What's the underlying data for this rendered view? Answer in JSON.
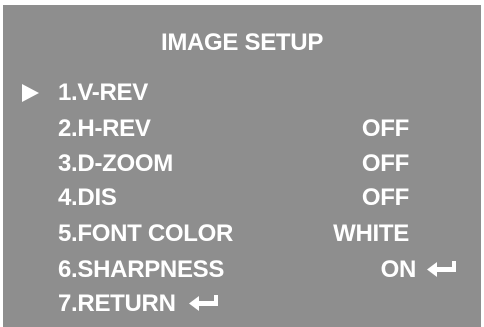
{
  "menu": {
    "title": "IMAGE SETUP",
    "accent_color": "#ffffff",
    "background_color": "#8e8e8e",
    "cursor_icon": "right-triangle-icon",
    "enter_icon": "enter-return-arrow-icon",
    "items": [
      {
        "label": "1.V-REV",
        "value": ""
      },
      {
        "label": "2.H-REV",
        "value": "OFF"
      },
      {
        "label": "3.D-ZOOM",
        "value": "OFF"
      },
      {
        "label": "4.DIS",
        "value": "OFF"
      },
      {
        "label": "5.FONT COLOR",
        "value": "WHITE"
      },
      {
        "label": "6.SHARPNESS",
        "value": "ON"
      },
      {
        "label": "7.RETURN",
        "value": ""
      }
    ]
  }
}
